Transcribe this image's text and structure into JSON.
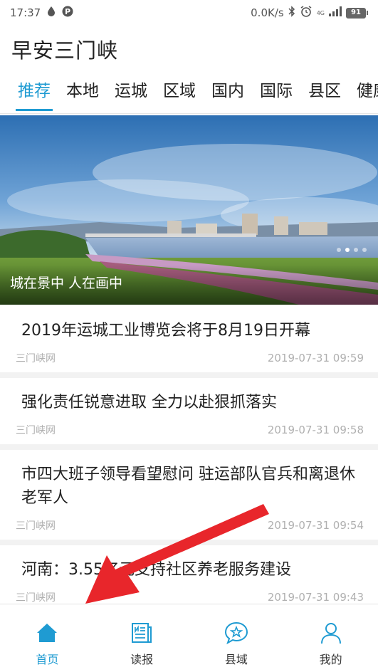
{
  "status_bar": {
    "time": "17:37",
    "speed": "0.0K/s",
    "network": "4G",
    "battery": "91",
    "left_icons": [
      "water-drop-icon",
      "parking-p-icon"
    ],
    "right_icons": [
      "bluetooth-icon",
      "alarm-clock-icon",
      "signal-icon"
    ]
  },
  "app": {
    "title": "早安三门峡"
  },
  "tabs": [
    {
      "label": "推荐",
      "active": true
    },
    {
      "label": "本地"
    },
    {
      "label": "运城"
    },
    {
      "label": "区域"
    },
    {
      "label": "国内"
    },
    {
      "label": "国际"
    },
    {
      "label": "县区"
    },
    {
      "label": "健康"
    }
  ],
  "banner": {
    "caption": "城在景中 人在画中",
    "slide_count": 4,
    "active_slide": 1
  },
  "news": [
    {
      "title": "2019年运城工业博览会将于8月19日开幕",
      "source": "三门峡网",
      "time": "2019-07-31 09:59"
    },
    {
      "title": "强化责任锐意进取 全力以赴狠抓落实",
      "source": "三门峡网",
      "time": "2019-07-31 09:58"
    },
    {
      "title": "市四大班子领导看望慰问 驻运部队官兵和离退休老军人",
      "source": "三门峡网",
      "time": "2019-07-31 09:54"
    },
    {
      "title": "河南：3.55亿元支持社区养老服务建设",
      "source": "三门峡网",
      "time": "2019-07-31 09:43"
    }
  ],
  "bottom_nav": [
    {
      "label": "首页",
      "icon": "home-icon",
      "active": true
    },
    {
      "label": "读报",
      "icon": "newspaper-icon"
    },
    {
      "label": "县域",
      "icon": "star-chat-icon"
    },
    {
      "label": "我的",
      "icon": "person-icon"
    }
  ],
  "colors": {
    "accent": "#1f9bd2",
    "arrow": "#e8262b"
  }
}
